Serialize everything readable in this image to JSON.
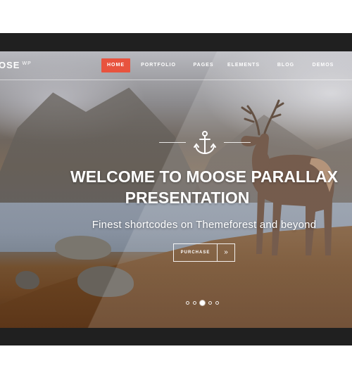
{
  "logo": {
    "text": "OSE",
    "sup": "WP"
  },
  "nav": {
    "items": [
      {
        "label": "HOME",
        "active": true
      },
      {
        "label": "PORTFOLIO",
        "active": false
      },
      {
        "label": "PAGES",
        "active": false
      },
      {
        "label": "ELEMENTS",
        "active": false
      },
      {
        "label": "BLOG",
        "active": false
      },
      {
        "label": "DEMOS",
        "active": false
      }
    ]
  },
  "hero": {
    "icon": "anchor-icon",
    "headline_line1": "WELCOME TO MOOSE PARALLAX",
    "headline_line2": "PRESENTATION",
    "subtitle": "Finest shortcodes on Themeforest and beyond",
    "cta_label": "PURCHASE",
    "cta_arrow": "»"
  },
  "slider": {
    "count": 5,
    "active_index": 2
  },
  "colors": {
    "accent": "#e8533e",
    "frame": "#202020",
    "text": "#ffffff"
  }
}
